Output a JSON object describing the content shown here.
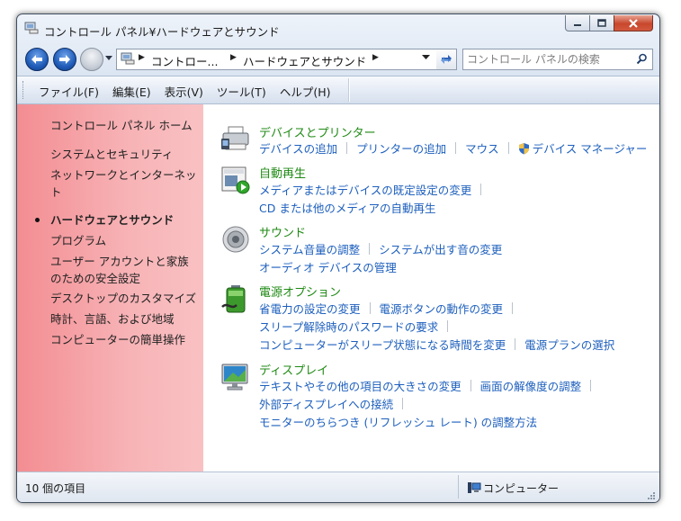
{
  "window": {
    "title": "コントロール パネル¥ハードウェアとサウンド"
  },
  "address": {
    "crumbs": [
      "コントロー...",
      "ハードウェアとサウンド"
    ]
  },
  "search": {
    "placeholder": "コントロール パネルの検索"
  },
  "menu": [
    "ファイル(F)",
    "編集(E)",
    "表示(V)",
    "ツール(T)",
    "ヘルプ(H)"
  ],
  "sidebar": {
    "items": [
      "コントロール パネル ホーム",
      "システムとセキュリティ",
      "ネットワークとインターネット",
      "ハードウェアとサウンド",
      "プログラム",
      "ユーザー アカウントと家族のための安全設定",
      "デスクトップのカスタマイズ",
      "時計、言語、および地域",
      "コンピューターの簡単操作"
    ]
  },
  "categories": [
    {
      "title": "デバイスとプリンター",
      "icon": "devices-printers-icon",
      "rows": [
        [
          "デバイスの追加",
          "プリンターの追加",
          "マウス",
          "デバイス マネージャー"
        ]
      ]
    },
    {
      "title": "自動再生",
      "icon": "autoplay-icon",
      "rows": [
        [
          "メディアまたはデバイスの既定設定の変更"
        ],
        [
          "CD または他のメディアの自動再生"
        ]
      ]
    },
    {
      "title": "サウンド",
      "icon": "speaker-icon",
      "rows": [
        [
          "システム音量の調整",
          "システムが出す音の変更"
        ],
        [
          "オーディオ デバイスの管理"
        ]
      ]
    },
    {
      "title": "電源オプション",
      "icon": "battery-icon",
      "rows": [
        [
          "省電力の設定の変更",
          "電源ボタンの動作の変更"
        ],
        [
          "スリープ解除時のパスワードの要求"
        ],
        [
          "コンピューターがスリープ状態になる時間を変更",
          "電源プランの選択"
        ]
      ]
    },
    {
      "title": "ディスプレイ",
      "icon": "display-icon",
      "rows": [
        [
          "テキストやその他の項目の大きさの変更",
          "画面の解像度の調整"
        ],
        [
          "外部ディスプレイへの接続"
        ],
        [
          "モニターのちらつき (リフレッシュ レート) の調整方法"
        ]
      ]
    }
  ],
  "status": {
    "count": "10 個の項目",
    "location": "コンピューター"
  }
}
